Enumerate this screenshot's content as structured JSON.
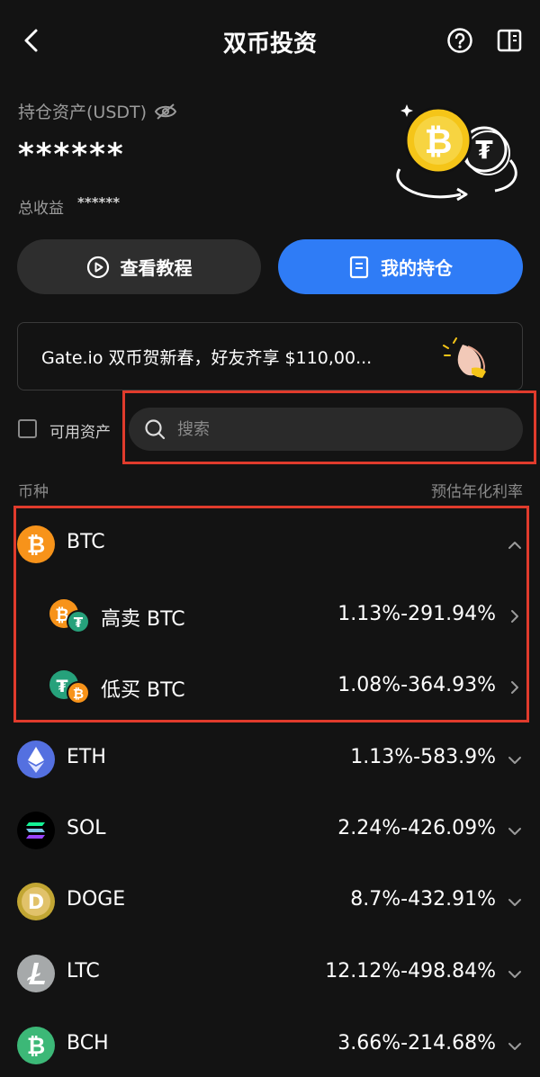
{
  "header": {
    "title": "双币投资"
  },
  "assets": {
    "label": "持仓资产(USDT)",
    "value": "******",
    "profit_label": "总收益",
    "profit_value": "******"
  },
  "actions": {
    "tutorial_label": "查看教程",
    "holdings_label": "我的持仓"
  },
  "banner": {
    "text": "Gate.io 双币贺新春，好友齐享 $110,00..."
  },
  "filter": {
    "available_label": "可用资产",
    "search_placeholder": "搜索"
  },
  "list": {
    "col_left": "币种",
    "col_right": "预估年化利率",
    "btc": {
      "name": "BTC",
      "sub": [
        {
          "name": "高卖 BTC",
          "rate": "1.13%-291.94%"
        },
        {
          "name": "低买 BTC",
          "rate": "1.08%-364.93%"
        }
      ]
    },
    "coins": [
      {
        "name": "ETH",
        "rate": "1.13%-583.9%"
      },
      {
        "name": "SOL",
        "rate": "2.24%-426.09%"
      },
      {
        "name": "DOGE",
        "rate": "8.7%-432.91%"
      },
      {
        "name": "LTC",
        "rate": "12.12%-498.84%"
      },
      {
        "name": "BCH",
        "rate": "3.66%-214.68%"
      }
    ]
  },
  "colors": {
    "background": "#131313",
    "accent": "#2f7cf6",
    "highlight": "#e03b2c",
    "btc": "#f7931a",
    "usdt": "#26a17b"
  }
}
